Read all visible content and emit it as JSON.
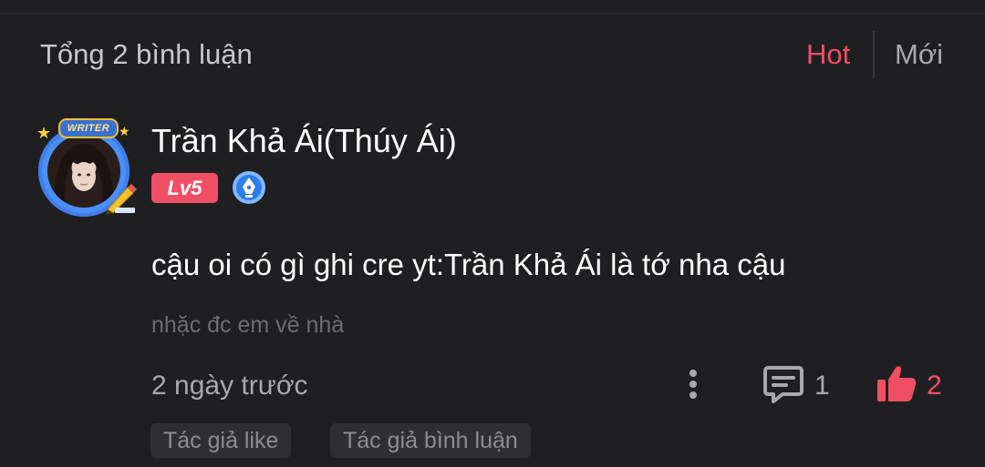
{
  "header": {
    "comment_count_label": "Tổng 2 bình luận",
    "sort_options": [
      "Hot",
      "Mới"
    ],
    "active_sort": "Hot"
  },
  "comment": {
    "author": {
      "name": "Trần Khả Ái(Thúy Ái)",
      "level": "Lv5",
      "avatar_frame_text": "WRITER",
      "badge_icon": "pen-nib-icon"
    },
    "text": "cậu oi có gì ghi cre yt:Trần Khả Ái là tớ nha cậu",
    "reply_hint": "nhặc đc em về nhà",
    "time": "2 ngày trước",
    "reply_count": "1",
    "like_count": "2",
    "tags": [
      "Tác giả like",
      "Tác giả bình luận"
    ]
  },
  "colors": {
    "background": "#1f1f21",
    "accent": "#f04e65",
    "muted_text": "#a9a9ac",
    "tag_background": "#2f2f32"
  }
}
